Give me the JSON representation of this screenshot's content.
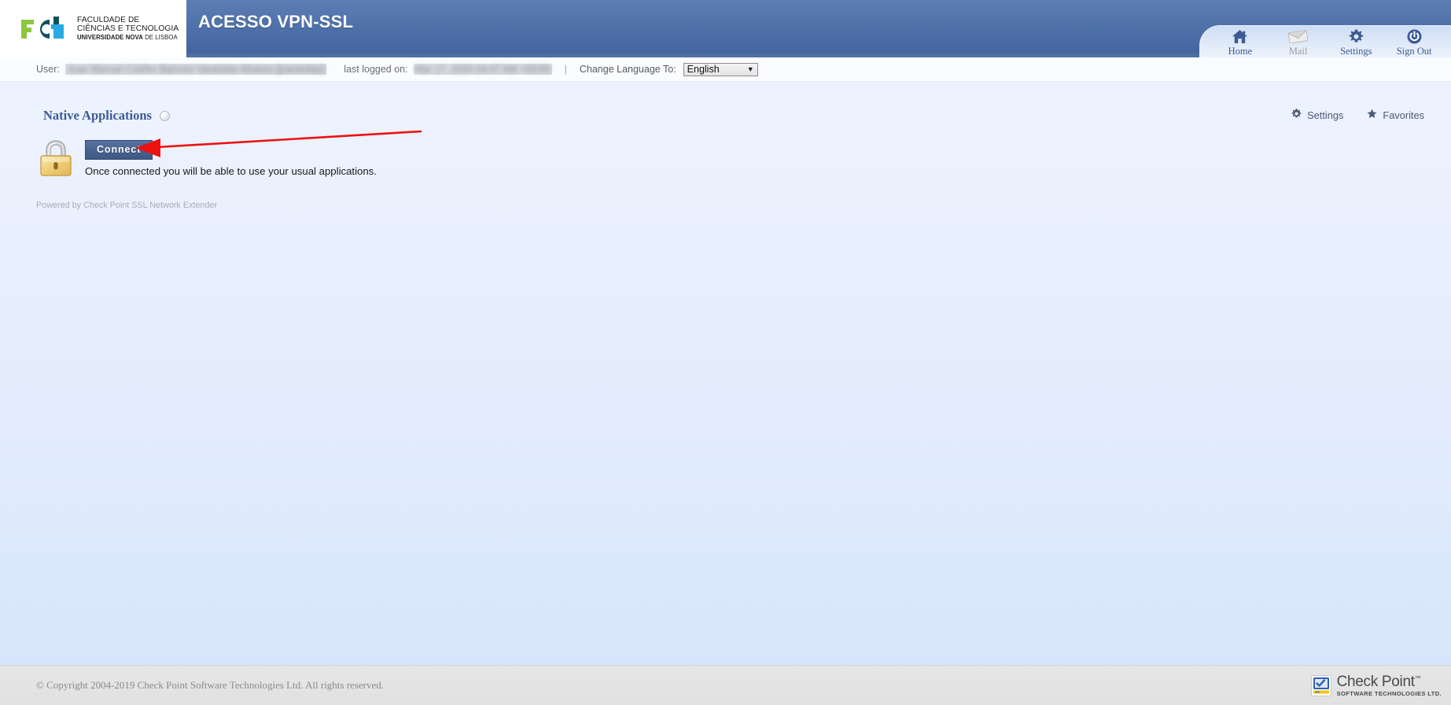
{
  "header": {
    "app_title": "ACESSO VPN-SSL",
    "logo": {
      "line1": "FACULDADE DE",
      "line2": "CIÊNCIAS E TECNOLOGIA",
      "line3_bold": "UNIVERSIDADE NOVA",
      "line3_rest": " DE LISBOA"
    },
    "nav": [
      {
        "label": "Home",
        "icon": "home-icon",
        "state": "active"
      },
      {
        "label": "Mail",
        "icon": "mail-icon",
        "state": "disabled"
      },
      {
        "label": "Settings",
        "icon": "gear-icon",
        "state": "active"
      },
      {
        "label": "Sign Out",
        "icon": "power-icon",
        "state": "active"
      }
    ]
  },
  "infobar": {
    "user_label": "User:",
    "user_value": "Joao Manuel Coelho Barroso Varandas Alvares (jvarandas)",
    "last_logged_label": "last logged on:",
    "last_logged_value": "Mar 17, 2020 04:47 AM +00:00",
    "separator": "|",
    "language_label": "Change Language To:",
    "language_selected": "English",
    "language_options": [
      "English"
    ]
  },
  "main": {
    "section_title": "Native Applications",
    "status_indicator": "idle-circle-icon",
    "tools": [
      {
        "label": "Settings",
        "icon": "gear-icon"
      },
      {
        "label": "Favorites",
        "icon": "star-icon"
      }
    ],
    "app": {
      "icon": "padlock-icon",
      "connect_label": "Connect",
      "description": "Once connected you will be able to use your usual applications."
    },
    "powered_by": "Powered by Check Point SSL Network Extender"
  },
  "annotation": {
    "type": "red-arrow",
    "color": "#ee1111",
    "points_to": "Connect"
  },
  "footer": {
    "copyright": "© Copyright 2004-2019 Check Point Software Technologies Ltd. All rights reserved.",
    "brand_name": "Check Point",
    "brand_tm": "™",
    "brand_sub": "SOFTWARE TECHNOLOGIES LTD."
  },
  "colors": {
    "header_blue": "#4a6aa3",
    "accent_link": "#3c5b94",
    "connect_button": "#4a6492",
    "annotation_red": "#ee1111",
    "page_background": "#e4eefc"
  }
}
